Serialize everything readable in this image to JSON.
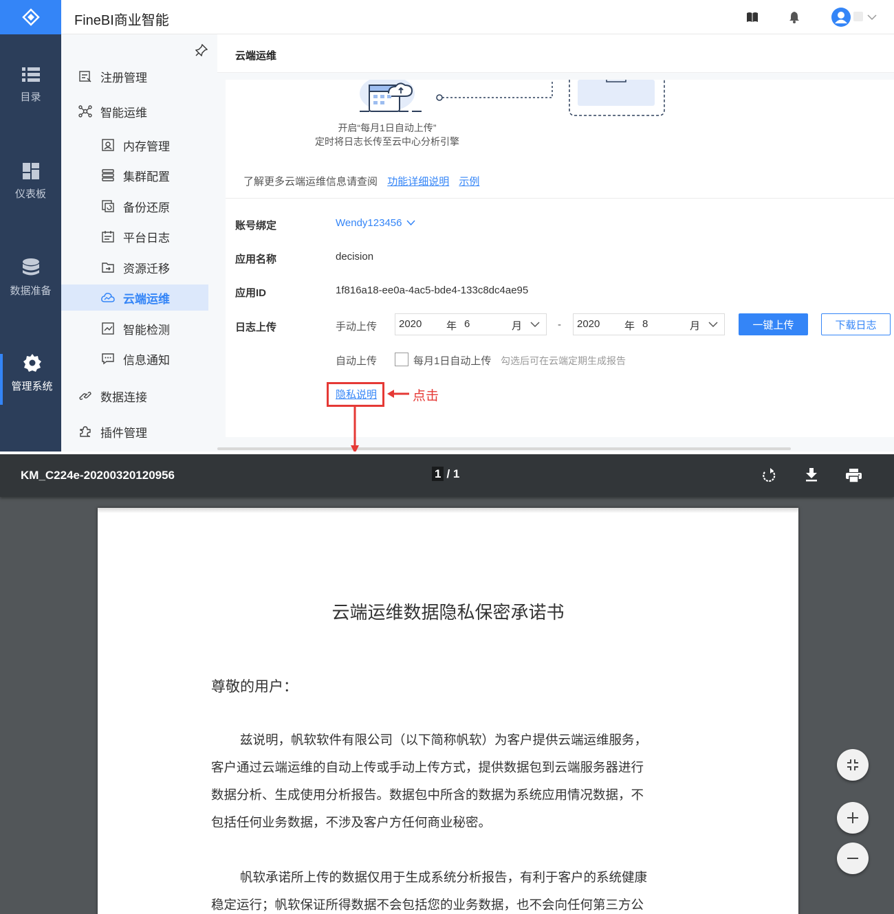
{
  "app": {
    "title": "FineBI商业智能"
  },
  "nav": [
    {
      "label": "目录",
      "icon": "list-icon"
    },
    {
      "label": "仪表板",
      "icon": "dashboard-icon"
    },
    {
      "label": "数据准备",
      "icon": "database-icon"
    },
    {
      "label": "管理系统",
      "icon": "gear-icon"
    }
  ],
  "sidebar": {
    "items": [
      {
        "label": "注册管理",
        "icon": "register-icon"
      },
      {
        "label": "智能运维",
        "icon": "network-icon"
      },
      {
        "label": "内存管理",
        "icon": "memory-icon"
      },
      {
        "label": "集群配置",
        "icon": "cluster-icon"
      },
      {
        "label": "备份还原",
        "icon": "backup-icon"
      },
      {
        "label": "平台日志",
        "icon": "log-icon"
      },
      {
        "label": "资源迁移",
        "icon": "migrate-icon"
      },
      {
        "label": "云端运维",
        "icon": "cloud-icon"
      },
      {
        "label": "智能检测",
        "icon": "detect-icon"
      },
      {
        "label": "信息通知",
        "icon": "message-icon"
      },
      {
        "label": "数据连接",
        "icon": "link-icon"
      },
      {
        "label": "插件管理",
        "icon": "plugin-icon"
      }
    ]
  },
  "panel": {
    "title": "云端运维",
    "illustration_caption_1": "开启“每月1日自动上传”",
    "illustration_caption_2": "定时将日志长传至云中心分析引擎",
    "more_info": "了解更多云端运维信息请查阅",
    "link_detail": "功能详细说明",
    "link_example": "示例",
    "account_label": "账号绑定",
    "account_value": "Wendy123456",
    "appname_label": "应用名称",
    "appname_value": "decision",
    "appid_label": "应用ID",
    "appid_value": "1f816a18-ee0a-4ac5-bde4-133c8dc4ae95",
    "log_label": "日志上传",
    "manual_label": "手动上传",
    "from_year": "2020",
    "from_month": "6",
    "to_year": "2020",
    "to_month": "8",
    "year_unit": "年",
    "month_unit": "月",
    "dash": "-",
    "upload_button": "一键上传",
    "download_button": "下载日志",
    "auto_label": "自动上传",
    "auto_checkbox": "每月1日自动上传",
    "auto_hint": "勾选后可在云端定期生成报告",
    "privacy_link": "隐私说明"
  },
  "annotation": {
    "text": "点击",
    "color": "#e53935"
  },
  "viewer": {
    "filename": "KM_C224e-20200320120956",
    "page_current": "1",
    "page_total": "/ 1"
  },
  "document": {
    "title": "云端运维数据隐私保密承诺书",
    "greeting": "尊敬的用户：",
    "p1_lines": [
      "兹说明，帆软软件有限公司（以下简称帆软）为客户提供云端运维服务，",
      "客户通过云端运维的自动上传或手动上传方式，提供数据包到云端服务器进行",
      "数据分析、生成使用分析报告。数据包中所含的数据为系统应用情况数据，不",
      "包括任何业务数据，不涉及客户方任何商业秘密。"
    ],
    "p2_lines": [
      "帆软承诺所上传的数据仅用于生成系统分析报告，有利于客户的系统健康",
      "稳定运行；帆软保证所得数据不会包括您的业务数据，也不会向任何第三方公"
    ]
  },
  "colors": {
    "accent": "#3485f7",
    "nav_bg": "#2c3e5a",
    "viewer_bg": "#525659",
    "viewer_toolbar": "#323639",
    "annotation": "#e53935"
  }
}
